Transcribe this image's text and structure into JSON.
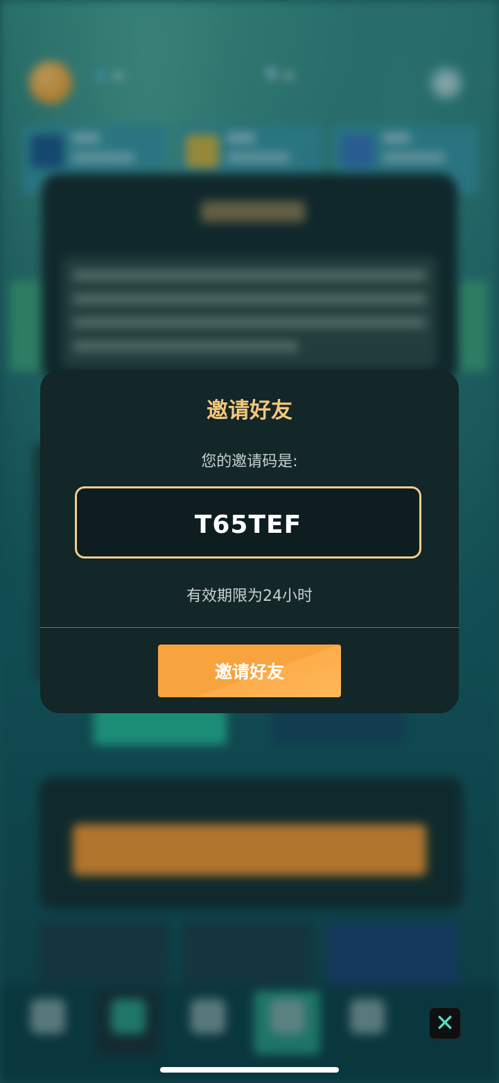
{
  "modal": {
    "title": "邀请好友",
    "code_label": "您的邀请码是:",
    "invite_code": "T65TEF",
    "validity": "有效期限为24小时",
    "button_label": "邀请好友"
  },
  "close_icon": "✕",
  "colors": {
    "modal_bg": "#132628",
    "title": "#f5c77a",
    "code_border": "#f2cf8a",
    "button": "#f7a33e",
    "divider": "#2b8f98",
    "close_icon": "#4fe0c0"
  }
}
